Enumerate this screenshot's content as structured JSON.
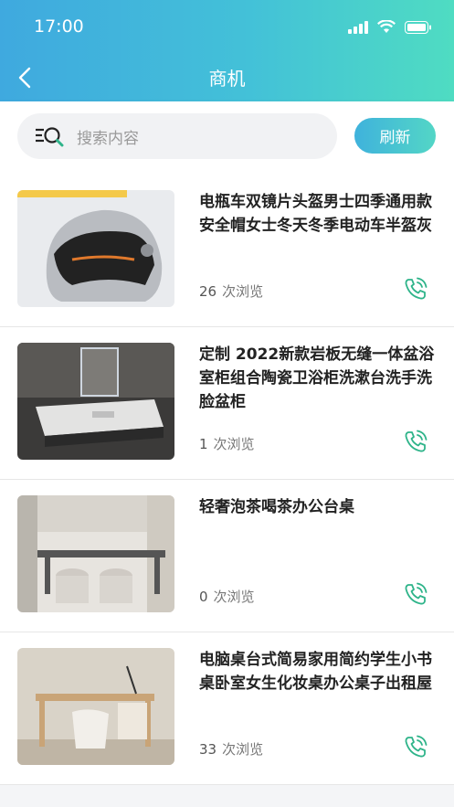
{
  "status": {
    "time": "17:00"
  },
  "nav": {
    "title": "商机"
  },
  "search": {
    "placeholder": "搜索内容",
    "refresh_label": "刷新"
  },
  "views_suffix": "次浏览",
  "items": [
    {
      "title": "电瓶车双镜片头盔男士四季通用款安全帽女士冬天冬季电动车半盔灰",
      "views": "26",
      "image": "helmet-image"
    },
    {
      "title": "定制 2022新款岩板无缝一体盆浴室柜组合陶瓷卫浴柜洗漱台洗手洗脸盆柜",
      "views": "1",
      "image": "bathroom-cabinet-image"
    },
    {
      "title": "轻奢泡茶喝茶办公台桌",
      "views": "0",
      "image": "tea-table-image"
    },
    {
      "title": "电脑桌台式简易家用简约学生小书桌卧室女生化妆桌办公桌子出租屋",
      "views": "33",
      "image": "desk-image"
    }
  ],
  "colors": {
    "header_start": "#3fa9df",
    "header_end": "#4fdcc2",
    "phone_icon": "#2fb48a"
  }
}
